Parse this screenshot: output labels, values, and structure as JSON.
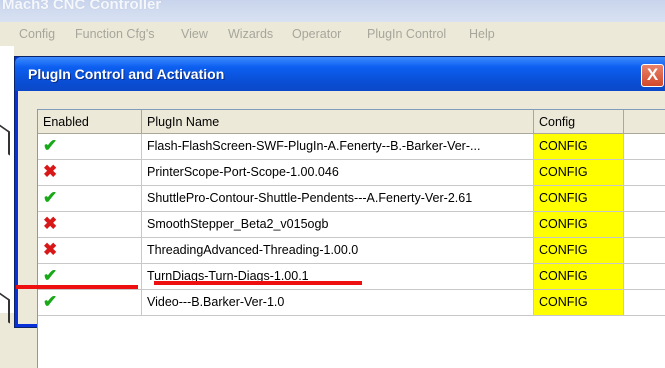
{
  "app": {
    "title": "Mach3 CNC Controller"
  },
  "menu": [
    "Config",
    "Function Cfg's",
    "View",
    "Wizards",
    "Operator",
    "PlugIn Control",
    "Help"
  ],
  "dialog": {
    "title": "PlugIn Control and Activation",
    "close_label": "X",
    "columns": [
      "Enabled",
      "PlugIn Name",
      "Config"
    ],
    "rows": [
      {
        "enabled": true,
        "icon": "check-icon",
        "name": "Flash-FlashScreen-SWF-PlugIn-A.Fenerty--B.-Barker-Ver-...",
        "config": "CONFIG"
      },
      {
        "enabled": false,
        "icon": "x-icon",
        "name": "PrinterScope-Port-Scope-1.00.046",
        "config": "CONFIG"
      },
      {
        "enabled": true,
        "icon": "check-icon",
        "name": "ShuttlePro-Contour-Shuttle-Pendents---A.Fenerty-Ver-2.61",
        "config": "CONFIG"
      },
      {
        "enabled": false,
        "icon": "x-icon",
        "name": "SmoothStepper_Beta2_v015ogb",
        "config": "CONFIG"
      },
      {
        "enabled": false,
        "icon": "x-icon",
        "name": "ThreadingAdvanced-Threading-1.00.0",
        "config": "CONFIG"
      },
      {
        "enabled": true,
        "icon": "check-icon",
        "name": "TurnDiags-Turn-Diags-1.00.1",
        "config": "CONFIG"
      },
      {
        "enabled": true,
        "icon": "check-icon",
        "name": "Video---B.Barker-Ver-1.0",
        "config": "CONFIG"
      }
    ]
  },
  "colors": {
    "config_bg": "#ffff00",
    "check": "#18a818",
    "x": "#d81818",
    "annotation": "#ee1010"
  }
}
